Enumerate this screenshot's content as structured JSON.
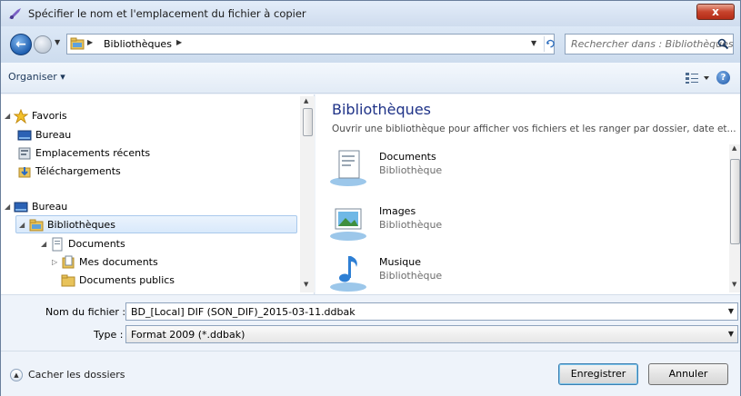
{
  "window": {
    "title": "Spécifier le nom et l'emplacement du fichier à copier",
    "close_label": "x"
  },
  "address": {
    "crumb": "Bibliothèques",
    "search_placeholder": "Rechercher dans : Bibliothèques"
  },
  "toolbar": {
    "organise_label": "Organiser ▾",
    "help_label": "?"
  },
  "nav": {
    "items": [
      {
        "label": "Favoris"
      },
      {
        "label": "Bureau"
      },
      {
        "label": "Emplacements récents"
      },
      {
        "label": "Téléchargements"
      },
      {
        "label": "Bureau"
      },
      {
        "label": "Bibliothèques"
      },
      {
        "label": "Documents"
      },
      {
        "label": "Mes documents"
      },
      {
        "label": "Documents publics"
      }
    ]
  },
  "content": {
    "title": "Bibliothèques",
    "description": "Ouvrir une bibliothèque pour afficher vos fichiers et les ranger par dossier, date et...",
    "libraries": [
      {
        "name": "Documents",
        "type": "Bibliothèque",
        "icon": "documents-library-icon"
      },
      {
        "name": "Images",
        "type": "Bibliothèque",
        "icon": "images-library-icon"
      },
      {
        "name": "Musique",
        "type": "Bibliothèque",
        "icon": "music-library-icon"
      }
    ]
  },
  "form": {
    "filename_label": "Nom du fichier :",
    "filename_value": "BD_[Local] DIF (SON_DIF)_2015-03-11.ddbak",
    "type_label": "Type :",
    "type_value": "Format 2009 (*.ddbak)"
  },
  "footer": {
    "hide_folders_label": "Cacher les dossiers",
    "save_label": "Enregistrer",
    "cancel_label": "Annuler"
  }
}
